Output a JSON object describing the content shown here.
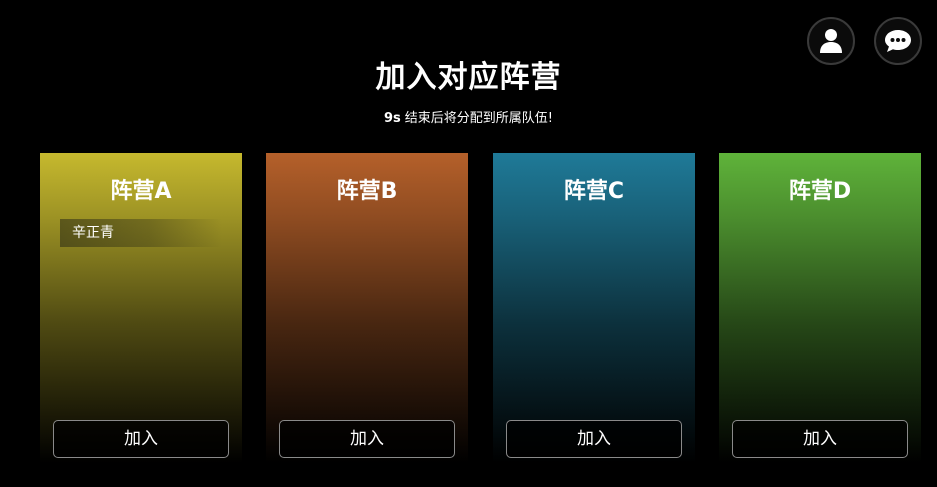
{
  "header": {
    "title": "加入对应阵营",
    "countdown": "9s",
    "subtitle": "结束后将分配到所属队伍!"
  },
  "top_buttons": {
    "profile_icon": "user-icon",
    "chat_icon": "chat-bubble-icon"
  },
  "camps": [
    {
      "name": "阵营A",
      "color": "#c6b92e",
      "members": [
        "辛正青"
      ],
      "join_label": "加入"
    },
    {
      "name": "阵营B",
      "color": "#b5602a",
      "members": [],
      "join_label": "加入"
    },
    {
      "name": "阵营C",
      "color": "#1f7a98",
      "members": [],
      "join_label": "加入"
    },
    {
      "name": "阵营D",
      "color": "#5fb33a",
      "members": [],
      "join_label": "加入"
    }
  ]
}
